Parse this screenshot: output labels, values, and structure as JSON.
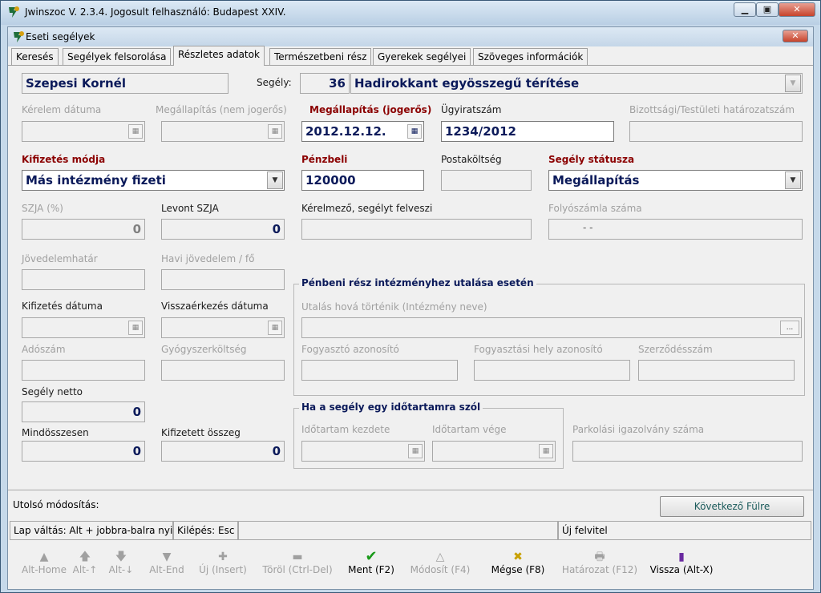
{
  "app": {
    "title": "Jwinszoc V. 2.3.4.  Jogosult felhasználó: Budapest XXIV.",
    "window_buttons": [
      "▁",
      "▣",
      "✕"
    ]
  },
  "inner": {
    "title": "Eseti segélyek",
    "close": "✕"
  },
  "tabs": [
    "Keresés",
    "Segélyek felsorolása",
    "Részletes adatok",
    "Természetbeni rész",
    "Gyerekek segélyei",
    "Szöveges információk"
  ],
  "form": {
    "name": "Szepesi Kornél",
    "segely_label": "Segély:",
    "segely_code": "36",
    "segely_name": "Hadirokkant egyösszegű térítése",
    "kerelem_datuma_label": "Kérelem dátuma",
    "megallapitas_nem_label": "Megállapítás (nem jogerős)",
    "megallapitas_jog_label": "Megállapítás (jogerős)",
    "megallapitas_jog_value": "2012.12.12.",
    "ugyiratszam_label": "Ügyiratszám",
    "ugyiratszam_value": "1234/2012",
    "bizottsagi_label": "Bizottsági/Testületi határozatszám",
    "kifizetes_modja_label": "Kifizetés módja",
    "kifizetes_modja_value": "Más intézmény fizeti",
    "penzbeli_label": "Pénzbeli",
    "penzbeli_value": "120000",
    "postakoltseg_label": "Postaköltség",
    "segely_statusza_label": "Segély státusza",
    "segely_statusza_value": "Megállapítás",
    "szja_label": "SZJA (%)",
    "szja_value": "0",
    "levont_szja_label": "Levont SZJA",
    "levont_szja_value": "0",
    "kerelmezo_label": "Kérelmező, segélyt felveszi",
    "folyoszamla_label": "Folyószámla száma",
    "folyoszamla_value": "-          -",
    "jovedelemhatar_label": "Jövedelemhatár",
    "havi_jovedelem_label": "Havi jövedelem / fő",
    "kifizetes_datuma_label": "Kifizetés dátuma",
    "visszaerkezes_label": "Visszaérkezés dátuma",
    "adoszam_label": "Adószám",
    "gyogyszer_label": "Gyógyszerköltség",
    "segely_netto_label": "Segély netto",
    "segely_netto_value": "0",
    "mindosszesen_label": "Mindösszesen",
    "mindosszesen_value": "0",
    "kifizetett_label": "Kifizetett összeg",
    "kifizetett_value": "0",
    "penzbeni_group_title": "Pénbeni rész intézményhez utalása esetén",
    "utalas_label": "Utalás hová történik (Intézmény neve)",
    "utalas_btn": "...",
    "fogyaszto_label": "Fogyasztó azonosító",
    "fogyasztasi_hely_label": "Fogyasztási hely azonosító",
    "szerzodes_label": "Szerződésszám",
    "idotartam_group_title": "Ha a segély egy időtartamra szól",
    "idotartam_kezdete_label": "Időtartam kezdete",
    "idotartam_vege_label": "Időtartam vége",
    "parkolasi_label": "Parkolási igazolvány száma"
  },
  "status": {
    "utolso_modositas": "Utolsó módosítás:",
    "kovetkezo_ful": "Következő Fülre",
    "lap_valtas": "Lap váltás: Alt + jobbra-balra nyil",
    "kilepes": "Kilépés: Esc",
    "uj_felvitel": "Új felvitel"
  },
  "toolbar": [
    {
      "icon": "▲",
      "label": "Alt-Home",
      "enabled": false
    },
    {
      "icon": "🡅",
      "label": "Alt-↑",
      "enabled": false
    },
    {
      "icon": "🡇",
      "label": "Alt-↓",
      "enabled": false
    },
    {
      "icon": "▼",
      "label": "Alt-End",
      "enabled": false
    },
    {
      "icon": "✚",
      "label": "Új (Insert)",
      "enabled": false
    },
    {
      "icon": "▬",
      "label": "Töröl (Ctrl-Del)",
      "enabled": false
    },
    {
      "icon": "✔",
      "label": "Ment (F2)",
      "enabled": true
    },
    {
      "icon": "△",
      "label": "Módosít (F4)",
      "enabled": false
    },
    {
      "icon": "✖",
      "label": "Mégse (F8)",
      "enabled": true
    },
    {
      "icon": "🖶",
      "label": "Határozat (F12)",
      "enabled": false
    },
    {
      "icon": "▮",
      "label": "Vissza (Alt-X)",
      "enabled": true
    }
  ],
  "colors": {
    "accent_red": "#8b0000",
    "value_navy": "#0b1a5a",
    "ok_green": "#1a9a1a"
  }
}
